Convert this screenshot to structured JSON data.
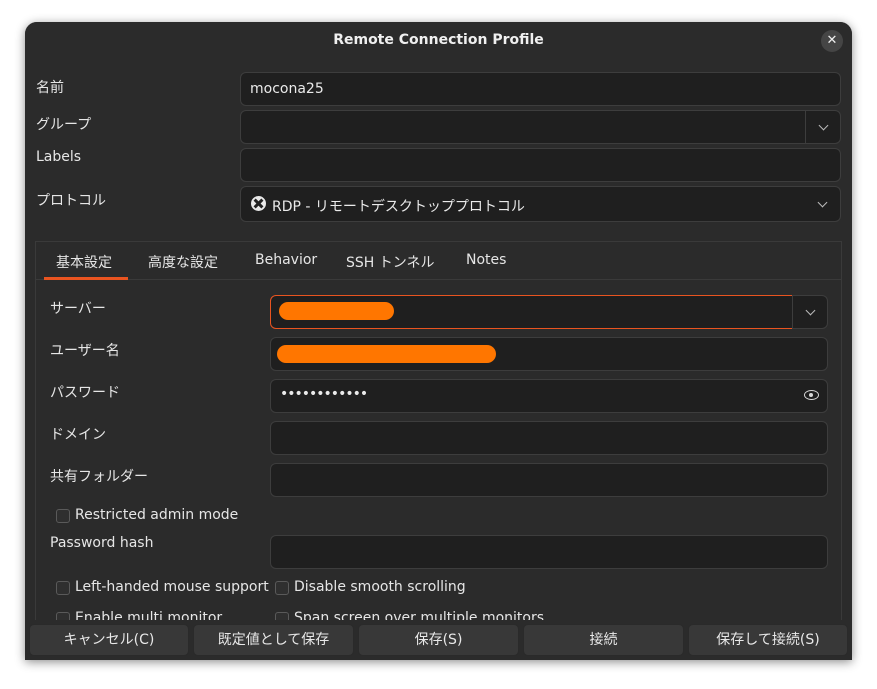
{
  "window": {
    "title": "Remote Connection Profile"
  },
  "profile": {
    "name_label": "名前",
    "name_value": "mocona25",
    "group_label": "グループ",
    "labels_label": "Labels",
    "protocol_label": "プロトコル",
    "protocol_value": "RDP - リモートデスクトッププロトコル"
  },
  "tabs": [
    {
      "label": "基本設定"
    },
    {
      "label": "高度な設定"
    },
    {
      "label": "Behavior"
    },
    {
      "label": "SSH トンネル"
    },
    {
      "label": "Notes"
    }
  ],
  "basic": {
    "server_label": "サーバー",
    "username_label": "ユーザー名",
    "password_label": "パスワード",
    "password_value": "••••••••••••",
    "domain_label": "ドメイン",
    "shared_folder_label": "共有フォルダー",
    "restricted_admin_label": "Restricted admin mode",
    "password_hash_label": "Password hash",
    "left_handed_label": "Left-handed mouse support",
    "disable_smooth_label": "Disable smooth scrolling",
    "multi_monitor_label": "Enable multi monitor",
    "span_screen_label": "Span screen over multiple monitors"
  },
  "footer": {
    "cancel": "キャンセル(C)",
    "save_default": "既定値として保存",
    "save": "保存(S)",
    "connect": "接続",
    "save_connect": "保存して接続(S)"
  },
  "colors": {
    "accent": "#e95420",
    "redaction": "#ff7600",
    "background": "#2b2b2b"
  },
  "icons": {
    "close": "close-icon",
    "protocol": "rdp-protocol-icon",
    "reveal": "eye-icon",
    "dropdown": "chevron-down-icon"
  }
}
